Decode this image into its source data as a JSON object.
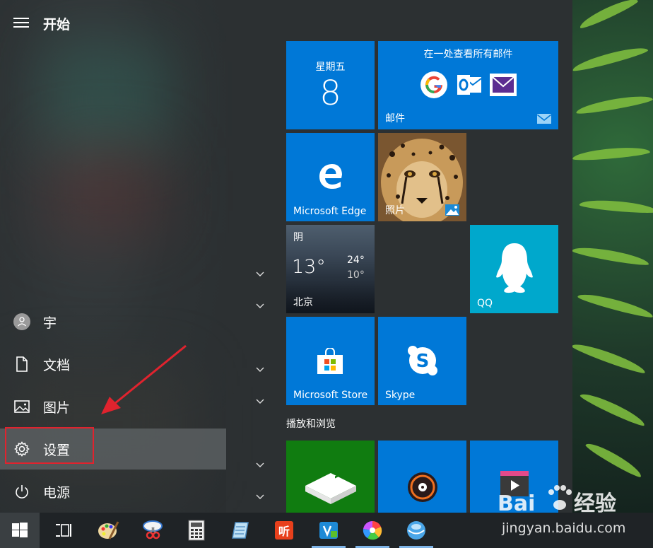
{
  "start": {
    "title": "开始",
    "user": "宇",
    "items": [
      {
        "label": "文档",
        "icon": "document-icon"
      },
      {
        "label": "图片",
        "icon": "pictures-icon"
      },
      {
        "label": "设置",
        "icon": "gear-icon"
      },
      {
        "label": "电源",
        "icon": "power-icon"
      }
    ]
  },
  "tiles": {
    "calendar": {
      "day": "星期五",
      "date": "8"
    },
    "mail": {
      "header": "在一处查看所有邮件",
      "label": "邮件"
    },
    "edge": {
      "label": "Microsoft Edge"
    },
    "photos": {
      "label": "照片"
    },
    "weather": {
      "condition": "阴",
      "temp": "13°",
      "high": "24°",
      "low": "10°",
      "city": "北京"
    },
    "qq": {
      "label": "QQ"
    },
    "store": {
      "label": "Microsoft Store"
    },
    "skype": {
      "label": "Skype"
    },
    "group_label": "播放和浏览"
  },
  "watermark": {
    "brand_prefix": "Bai",
    "brand_suffix": "经验",
    "url": "jingyan.baidu.com"
  },
  "colors": {
    "tile_blue": "#0078d7",
    "tile_green": "#107c10",
    "highlight_red": "#e0232e"
  }
}
